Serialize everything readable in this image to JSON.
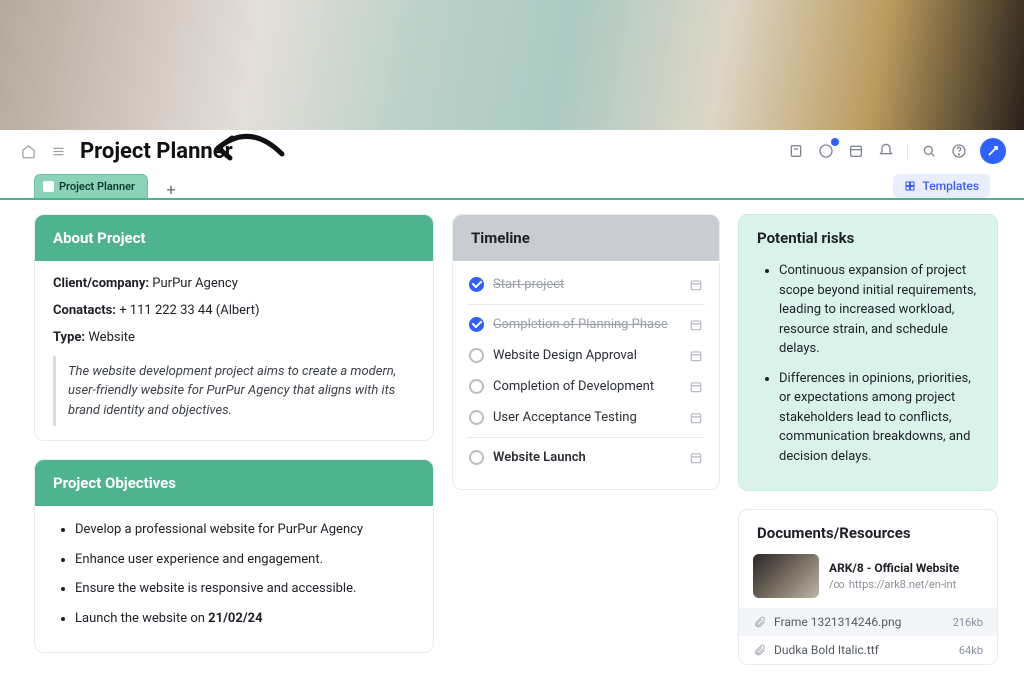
{
  "page_title": "Project Planner",
  "tab_label": "Project Planner",
  "templates_label": "Templates",
  "about": {
    "header": "About Project",
    "client_label": "Client/company:",
    "client_value": "PurPur Agency",
    "contacts_label": "Conatacts:",
    "contacts_value": "+ 111 222 33 44 (Albert)",
    "type_label": "Type:",
    "type_value": "Website",
    "desc": "The website development project aims to create a modern, user-friendly website for PurPur Agency that aligns with its brand identity and objectives."
  },
  "objectives": {
    "header": "Project Objectives",
    "items": [
      "Develop a professional website for PurPur Agency",
      "Enhance user experience and engagement.",
      "Ensure the website is responsive and accessible."
    ],
    "launch_prefix": "Launch the website on ",
    "launch_date": "21/02/24"
  },
  "timeline": {
    "header": "Timeline",
    "items": [
      {
        "label": "Start project",
        "done": true
      },
      {
        "label": "Completion of Planning Phase",
        "done": true
      },
      {
        "label": "Website Design Approval",
        "done": false
      },
      {
        "label": "Completion of Development",
        "done": false
      },
      {
        "label": "User Acceptance Testing",
        "done": false
      },
      {
        "label": "Website Launch",
        "done": false
      }
    ]
  },
  "risks": {
    "header": "Potential risks",
    "items": [
      "Continuous expansion of project scope beyond initial requirements, leading to increased workload, resource strain, and schedule delays.",
      "Differences in opinions, priorities, or expectations among project stakeholders lead to conflicts, communication breakdowns, and decision delays."
    ]
  },
  "docs": {
    "header": "Documents/Resources",
    "hero_title": "ARK/8 - Official Website",
    "hero_url": "https://ark8.net/en-int",
    "files": [
      {
        "name": "Frame 1321314246.png",
        "size": "216kb"
      },
      {
        "name": "Dudka Bold Italic.ttf",
        "size": "64kb"
      }
    ]
  }
}
